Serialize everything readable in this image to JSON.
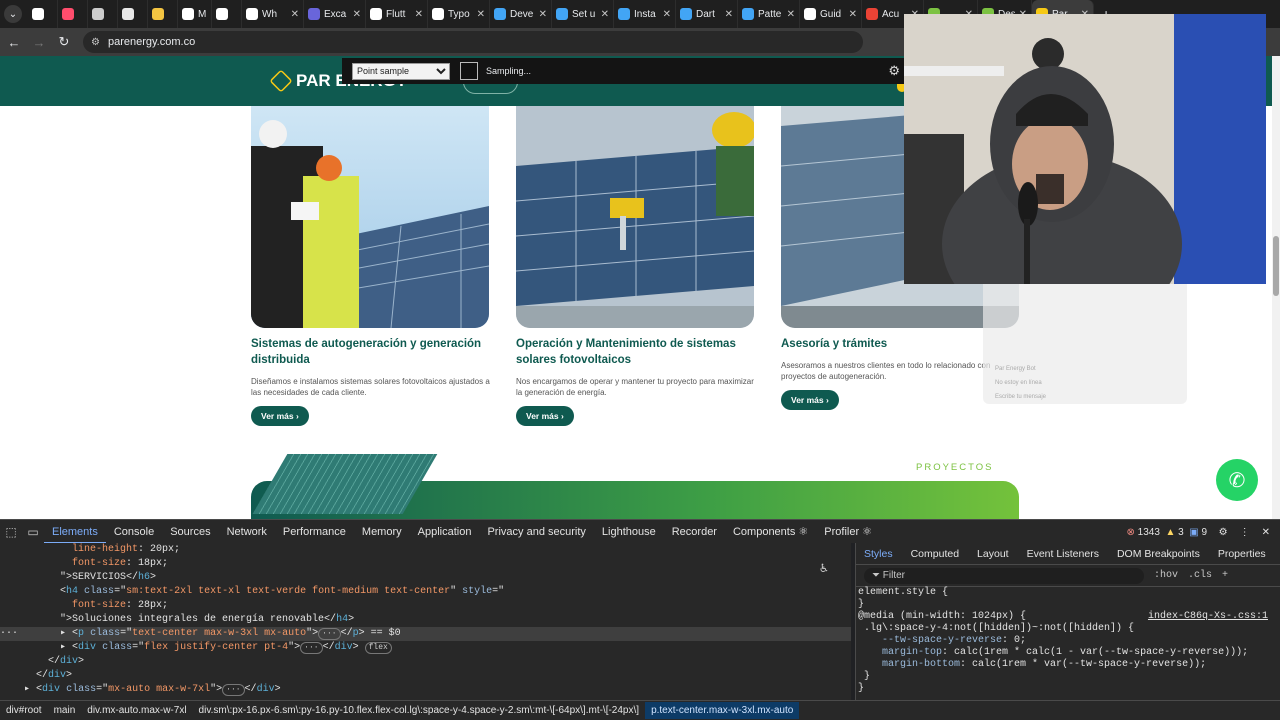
{
  "tabs": [
    {
      "label": "",
      "fav": "#ffffff",
      "icon": "github-icon"
    },
    {
      "label": "",
      "fav": "#ff4d6d",
      "icon": "app-icon"
    },
    {
      "label": "",
      "fav": "#cccccc",
      "icon": "app-icon"
    },
    {
      "label": "",
      "fav": "#e8e8e8",
      "icon": "app-icon"
    },
    {
      "label": "",
      "fav": "#f4c542",
      "icon": "duck-icon"
    },
    {
      "label": "Mi",
      "fav": "#ffffff",
      "icon": "app-icon"
    },
    {
      "label": "",
      "fav": "#ffffff",
      "icon": "app-icon"
    },
    {
      "label": "Wh",
      "fav": "#ffffff",
      "icon": "app-icon"
    },
    {
      "label": "Exca",
      "fav": "#6965db",
      "icon": "excalidraw-icon"
    },
    {
      "label": "Flutt",
      "fav": "#ffffff",
      "icon": "app-icon"
    },
    {
      "label": "Typo",
      "fav": "#ffffff",
      "icon": "app-icon"
    },
    {
      "label": "Deve",
      "fav": "#42a5f5",
      "icon": "flutter-icon"
    },
    {
      "label": "Set u",
      "fav": "#42a5f5",
      "icon": "flutter-icon"
    },
    {
      "label": "Insta",
      "fav": "#42a5f5",
      "icon": "flutter-icon"
    },
    {
      "label": "Dart",
      "fav": "#42a5f5",
      "icon": "dart-icon"
    },
    {
      "label": "Patte",
      "fav": "#42a5f5",
      "icon": "dart-icon"
    },
    {
      "label": "Guid",
      "fav": "#ffffff",
      "icon": "app-icon"
    },
    {
      "label": "Acu",
      "fav": "#ea4335",
      "icon": "gmail-icon"
    },
    {
      "label": "",
      "fav": "#7cc242",
      "icon": "app-icon"
    },
    {
      "label": "Desa",
      "fav": "#7cc242",
      "icon": "app-icon"
    },
    {
      "label": "Par",
      "fav": "#f6c915",
      "icon": "par-energy-icon",
      "active": true
    }
  ],
  "address": {
    "url": "parenergy.com.co"
  },
  "picker": {
    "mode": "Point sample",
    "status": "Sampling..."
  },
  "site": {
    "logo": "PAR ENERGY",
    "cards": [
      {
        "title": "Sistemas de autogeneración y generación distribuida",
        "desc": "Diseñamos e instalamos sistemas solares fotovoltaicos ajustados a las necesidades de cada cliente.",
        "button": "Ver más ›"
      },
      {
        "title": "Operación y Mantenimiento de sistemas solares fotovoltaicos",
        "desc": "Nos encargamos de operar y mantener tu proyecto para maximizar la generación de energía.",
        "button": "Ver más ›"
      },
      {
        "title": "Asesoría y trámites",
        "desc": "Asesoramos a nuestros clientes en todo lo relacionado con proyectos de autogeneración.",
        "button": "Ver más ›"
      }
    ],
    "projects_label": "PROYECTOS",
    "ghost_lines": [
      "Par Energy Bot",
      "No estoy en línea",
      "Escribe tu mensaje"
    ]
  },
  "devtools": {
    "tabs": [
      "Elements",
      "Console",
      "Sources",
      "Network",
      "Performance",
      "Memory",
      "Application",
      "Privacy and security",
      "Lighthouse",
      "Recorder",
      "Components ⚛",
      "Profiler ⚛"
    ],
    "errors": "1343",
    "warnings": "3",
    "info": "9",
    "styles_tabs": [
      "Styles",
      "Computed",
      "Layout",
      "Event Listeners",
      "DOM Breakpoints",
      "Properties"
    ],
    "filter_placeholder": "Filter",
    "filter_opts": [
      ":hov",
      ".cls"
    ],
    "breadcrumbs": [
      "div#root",
      "main",
      "div.mx-auto.max-w-7xl",
      "div.sm\\:px-16.px-6.sm\\:py-16.py-10.flex.flex-col.lg\\:space-y-4.space-y-2.sm\\:mt-\\[-64px\\].mt-\\[-24px\\]",
      "p.text-center.max-w-3xl.mx-auto"
    ]
  },
  "colors": {
    "brand": "#0f5a50",
    "accent": "#7cc242",
    "devtools_bg": "#282828"
  }
}
